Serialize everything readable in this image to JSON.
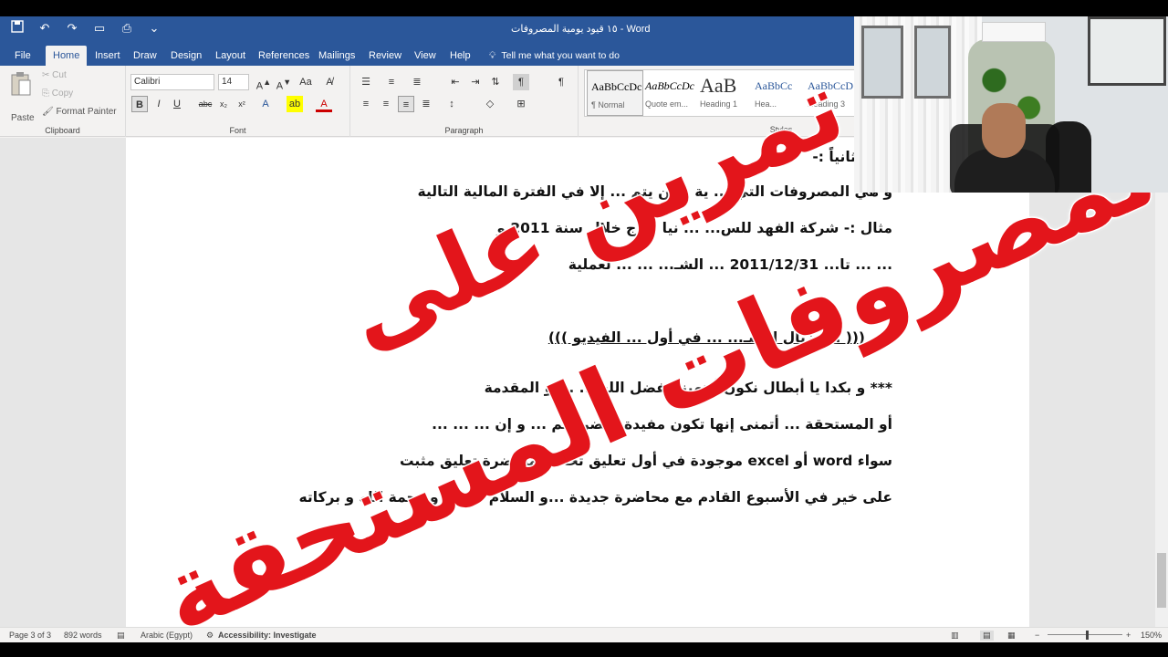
{
  "window": {
    "title": "١٥ قيود يومية المصروفات  -  Word"
  },
  "qat_icons": [
    "save-icon",
    "undo-icon",
    "redo-icon",
    "folder-icon",
    "print-icon",
    "customize-icon"
  ],
  "tabs": [
    "File",
    "Home",
    "Insert",
    "Draw",
    "Design",
    "Layout",
    "References",
    "Mailings",
    "Review",
    "View",
    "Help"
  ],
  "tell_me": "Tell me what you want to do",
  "clipboard": {
    "paste": "Paste",
    "cut": "Cut",
    "copy": "Copy",
    "format_painter": "Format Painter",
    "label": "Clipboard"
  },
  "font": {
    "name": "Calibri",
    "size": "14",
    "label": "Font"
  },
  "paragraph": {
    "label": "Paragraph"
  },
  "styles": {
    "label": "Styles",
    "items": [
      {
        "preview": "AaBbCcDc",
        "name": "¶ Normal"
      },
      {
        "preview": "AaBbCcDc",
        "name": "Quote em..."
      },
      {
        "preview": "AaB",
        "name": "Heading 1"
      },
      {
        "preview": "AaBbCc",
        "name": "Hea..."
      },
      {
        "preview": "AaBbCcD",
        "name": "Heading 3"
      }
    ]
  },
  "document": {
    "lines": [
      "ثانياً :-",
      "و هي المصروفات التي ... ية و لن يتم ... إلا في الفترة المالية التالية",
      "مثال :-  شركة الفهد للس... ... نيا ... ج خلال سنة 2011 و",
      "... ... تا... 2011/12/31 ... الشـ... ... ... لعملية",
      "((( ... نزيال إحسـ... ... في أول ... الفيديو )))",
      "*** و بكدا يا أبطال نكون أنتهينا بفضل الله ... ... و المقدمة",
      "أو المستحقة ... أتمنى إنها تكون مفيدة لحضراتكم ... و إن ... ... ...",
      "سواء  word  أو  excel  موجودة في أول تعليق تحت المحاضرة تعليق مثبت",
      "على خير في الأسبوع القادم مع محاضرة جديدة ...و السلام عليكم و رحمة الله و بركاته"
    ]
  },
  "overlay": {
    "line1": "تمرين على",
    "line2": "المصروفات المستحقة",
    "color": "#e3151b"
  },
  "status": {
    "page": "Page 3 of 3",
    "words": "892 words",
    "language": "Arabic (Egypt)",
    "accessibility": "Accessibility: Investigate",
    "zoom": "150%"
  },
  "colors": {
    "ribbon_blue": "#2b579a"
  }
}
